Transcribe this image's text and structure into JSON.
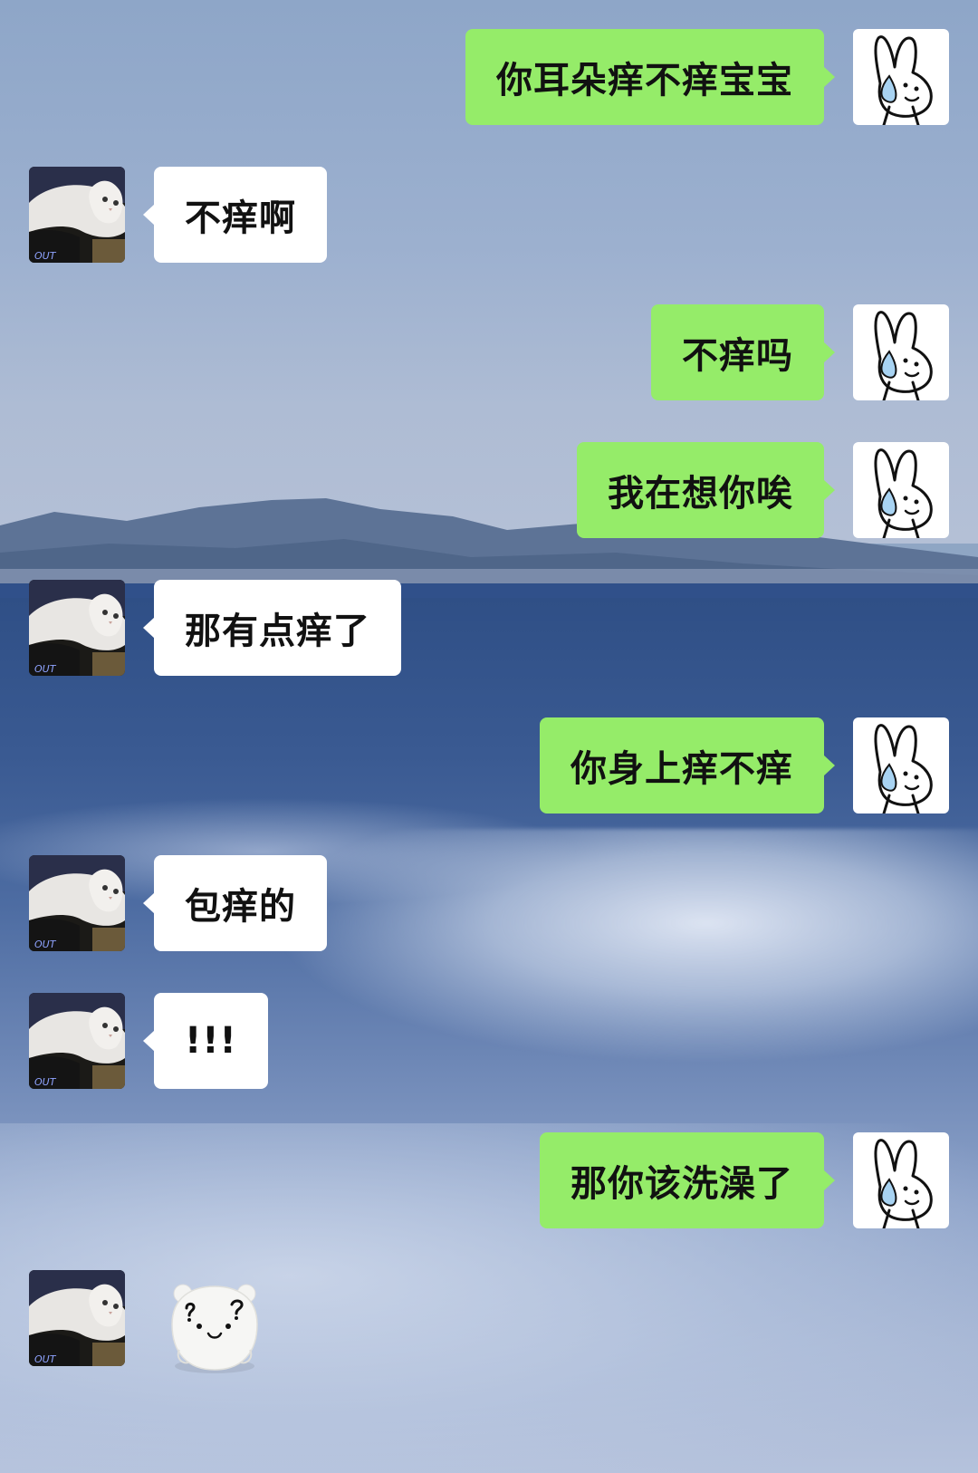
{
  "chat": {
    "messages": [
      {
        "side": "out",
        "text": "你耳朵痒不痒宝宝"
      },
      {
        "side": "in",
        "text": "不痒啊"
      },
      {
        "side": "out",
        "text": "不痒吗"
      },
      {
        "side": "out",
        "text": "我在想你唉"
      },
      {
        "side": "in",
        "text": "那有点痒了"
      },
      {
        "side": "out",
        "text": "你身上痒不痒"
      },
      {
        "side": "in",
        "text": "包痒的"
      },
      {
        "side": "in",
        "text": "!!!"
      },
      {
        "side": "out",
        "text": "那你该洗澡了"
      },
      {
        "side": "in",
        "sticker": "bear-question-sticker"
      }
    ]
  },
  "avatars": {
    "me": "rabbit-sweat-icon",
    "contact": "white-cat-photo"
  },
  "colors": {
    "outgoing_bubble": "#95ec69",
    "incoming_bubble": "#ffffff",
    "text": "#111111"
  }
}
